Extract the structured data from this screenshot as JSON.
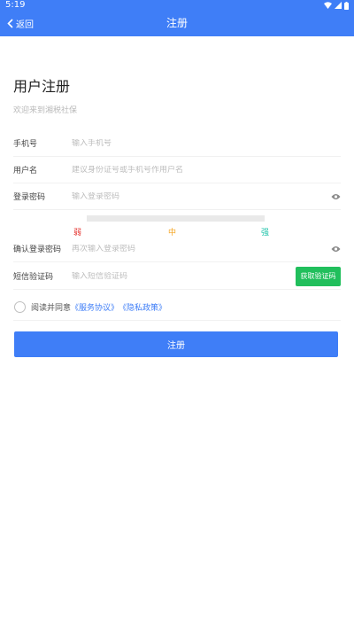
{
  "status_bar": {
    "time": "5:19"
  },
  "nav": {
    "back_label": "返回",
    "title": "注册"
  },
  "page": {
    "title": "用户注册",
    "subtitle": "欢迎来到湘税社保"
  },
  "form": {
    "phone": {
      "label": "手机号",
      "placeholder": "输入手机号",
      "value": ""
    },
    "username": {
      "label": "用户名",
      "placeholder": "建议身份证号或手机号作用户名",
      "value": ""
    },
    "password": {
      "label": "登录密码",
      "placeholder": "输入登录密码",
      "value": ""
    },
    "strength": {
      "weak": "弱",
      "medium": "中",
      "strong": "强",
      "weak_color": "#e53935",
      "medium_color": "#f5a623",
      "strong_color": "#1cc2a8"
    },
    "confirm": {
      "label": "确认登录密码",
      "placeholder": "再次输入登录密码",
      "value": ""
    },
    "sms": {
      "label": "短信验证码",
      "placeholder": "输入短信验证码",
      "value": "",
      "button": "获取验证码"
    }
  },
  "agreement": {
    "prefix": "阅读并同意",
    "service": "《服务协议》",
    "privacy": "《隐私政策》",
    "checked": false
  },
  "submit_label": "注册",
  "colors": {
    "primary": "#3f7ef7",
    "sms_button": "#21bf5c"
  },
  "icons": {
    "back": "chevron-left-icon",
    "password_eye": "eye-icon",
    "wifi": "wifi-icon",
    "signal": "signal-icon",
    "battery": "battery-icon"
  }
}
